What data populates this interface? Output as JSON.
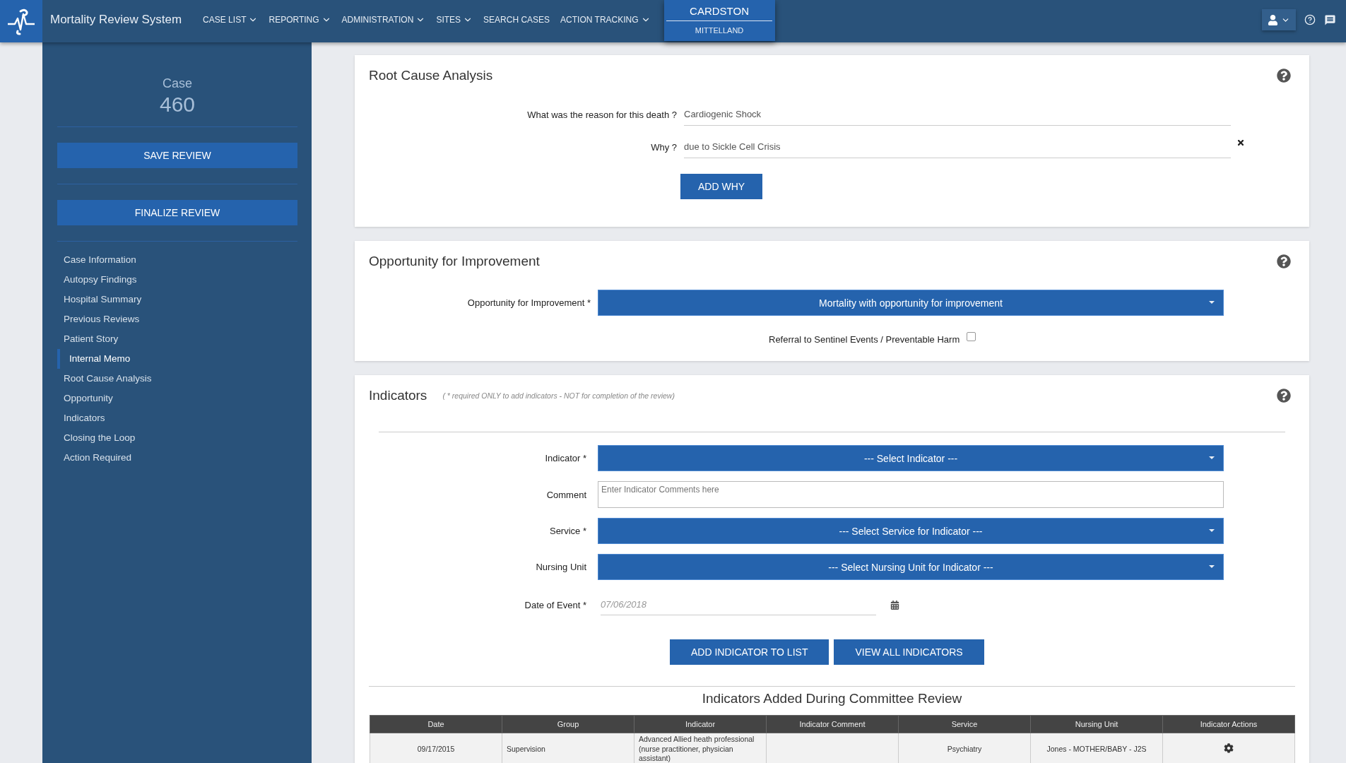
{
  "app": {
    "title": "Mortality Review System"
  },
  "nav": [
    {
      "label": "CASE LIST",
      "dropdown": true
    },
    {
      "label": "REPORTING",
      "dropdown": true
    },
    {
      "label": "ADMINISTRATION",
      "dropdown": true
    },
    {
      "label": "SITES",
      "dropdown": true
    },
    {
      "label": "SEARCH CASES",
      "dropdown": false
    },
    {
      "label": "ACTION TRACKING",
      "dropdown": true
    }
  ],
  "site_switcher": {
    "current": "CARDSTON",
    "options": [
      "MITTELLAND"
    ]
  },
  "sidebar": {
    "case_label": "Case",
    "case_number": "460",
    "buttons": [
      "SAVE REVIEW",
      "FINALIZE REVIEW"
    ],
    "items": [
      {
        "label": "Case Information",
        "selected": false
      },
      {
        "label": "Autopsy Findings",
        "selected": false
      },
      {
        "label": "Hospital Summary",
        "selected": false
      },
      {
        "label": "Previous Reviews",
        "selected": false
      },
      {
        "label": "Patient Story",
        "selected": false
      },
      {
        "label": "Internal Memo",
        "selected": true
      },
      {
        "label": "Root Cause Analysis",
        "selected": false
      },
      {
        "label": "Opportunity",
        "selected": false
      },
      {
        "label": "Indicators",
        "selected": false
      },
      {
        "label": "Closing the Loop",
        "selected": false
      },
      {
        "label": "Action Required",
        "selected": false
      }
    ]
  },
  "root_cause": {
    "title": "Root Cause Analysis",
    "fields": [
      {
        "label": "What was the reason for this death ?",
        "value": "Cardiogenic Shock",
        "removable": false
      },
      {
        "label": "Why ?",
        "value": "due to Sickle Cell Crisis",
        "removable": true
      }
    ],
    "add_button": "ADD WHY"
  },
  "opportunity": {
    "title": "Opportunity for Improvement",
    "field_label": "Opportunity for Improvement *",
    "value": "Mortality with opportunity for improvement",
    "checkbox_label": "Referral to Sentinel Events / Preventable Harm",
    "checked": false
  },
  "indicators": {
    "title": "Indicators",
    "note": "( * required ONLY to add indicators - NOT for completion of the review)",
    "fields": [
      {
        "kind": "select",
        "label": "Indicator *",
        "value": "--- Select Indicator ---"
      },
      {
        "kind": "textarea",
        "label": "Comment",
        "placeholder": "Enter Indicator Comments here"
      },
      {
        "kind": "select",
        "label": "Service *",
        "value": "--- Select Service for Indicator ---"
      },
      {
        "kind": "select",
        "label": "Nursing Unit",
        "value": "--- Select Nursing Unit for Indicator ---"
      },
      {
        "kind": "date",
        "label": "Date of Event *",
        "placeholder": "07/06/2018"
      }
    ],
    "buttons": [
      "ADD INDICATOR TO LIST",
      "VIEW ALL INDICATORS"
    ],
    "table_title": "Indicators Added During Committee Review",
    "table": {
      "columns": [
        "Date",
        "Group",
        "Indicator",
        "Indicator Comment",
        "Service",
        "Nursing Unit",
        "Indicator Actions"
      ],
      "rows": [
        {
          "date": "09/17/2015",
          "group": "Supervision",
          "indicator": "Advanced Allied heath professional (nurse practitioner, physician assistant)",
          "service": "Psychiatry",
          "nursing_unit": "Jones - MOTHER/BABY - J2S"
        }
      ]
    }
  }
}
